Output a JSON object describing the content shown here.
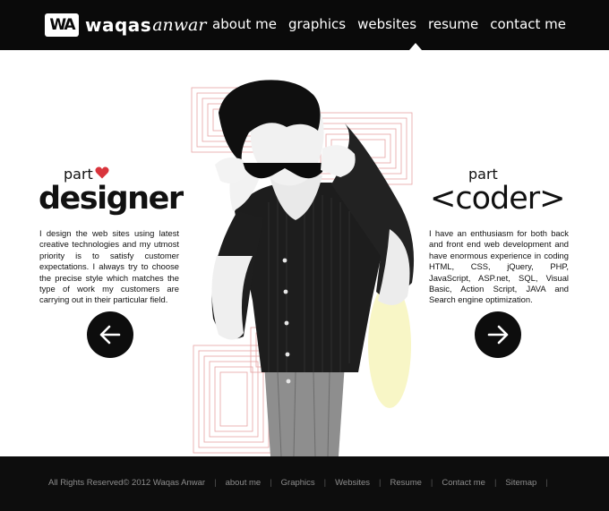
{
  "brand": {
    "mark": "WA",
    "first": "waqas",
    "last": "anwar"
  },
  "nav": [
    {
      "label": "about me"
    },
    {
      "label": "graphics"
    },
    {
      "label": "websites"
    },
    {
      "label": "resume"
    },
    {
      "label": "contact me"
    }
  ],
  "nav_active": "websites",
  "left": {
    "part": "part",
    "title": "designer",
    "body": "I design the web sites using latest creative technologies and my utmost priority is to satisfy customer expectations. I always try to choose the precise style which matches the type of work my customers are carrying out in their particular field."
  },
  "right": {
    "part": "part",
    "title": "<coder>",
    "body": "I have an enthusiasm for both back and front end web development and have enormous experience in coding HTML, CSS, jQuery, PHP, JavaScript, ASP.net, SQL, Visual Basic, Action Script, JAVA and Search engine optimization."
  },
  "footer": {
    "copyright": "All Rights Reserved© 2012 Waqas Anwar",
    "links": [
      "about me",
      "Graphics",
      "Websites",
      "Resume",
      "Contact me",
      "Sitemap"
    ]
  },
  "colors": {
    "accent": "#d9343c",
    "line_art": "#e7a3a3",
    "glow": "#f3ef97"
  },
  "icons": {
    "heart": "heart-icon",
    "prev": "arrow-left-icon",
    "next": "arrow-right-icon"
  }
}
